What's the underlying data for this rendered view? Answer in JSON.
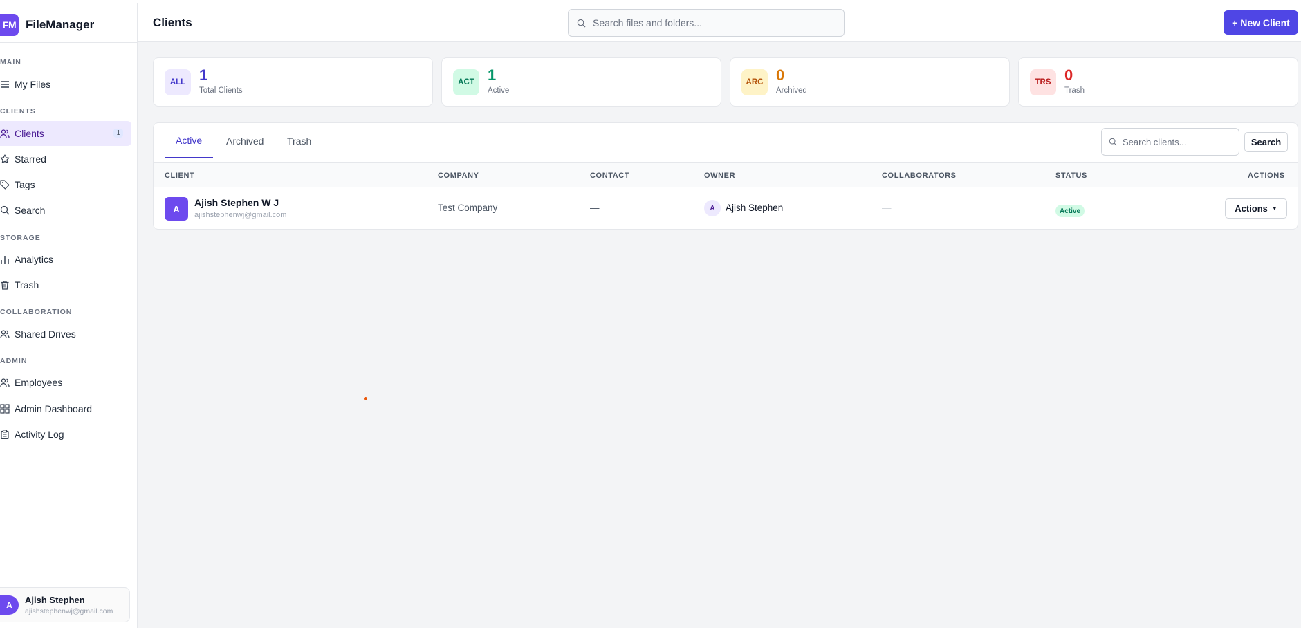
{
  "app": {
    "logo_text": "FM",
    "name": "FileManager"
  },
  "sidebar": {
    "sections": [
      {
        "label": "MAIN"
      },
      {
        "label": "CLIENTS"
      },
      {
        "label": "STORAGE"
      },
      {
        "label": "COLLABORATION"
      },
      {
        "label": "ADMIN"
      }
    ],
    "items": [
      {
        "label": "My Files",
        "icon": "menu-icon"
      },
      {
        "label": "Clients",
        "icon": "users-icon",
        "badge": "1",
        "active": true
      },
      {
        "label": "Starred",
        "icon": "star-icon"
      },
      {
        "label": "Tags",
        "icon": "tag-icon"
      },
      {
        "label": "Search",
        "icon": "search-icon"
      },
      {
        "label": "Analytics",
        "icon": "bar-chart-icon"
      },
      {
        "label": "Trash",
        "icon": "trash-icon"
      },
      {
        "label": "Shared Drives",
        "icon": "users-icon"
      },
      {
        "label": "Employees",
        "icon": "users-icon"
      },
      {
        "label": "Admin Dashboard",
        "icon": "grid-icon"
      },
      {
        "label": "Activity Log",
        "icon": "clipboard-icon"
      }
    ],
    "user": {
      "initial": "A",
      "name": "Ajish Stephen",
      "email": "ajishstephenwj@gmail.com"
    }
  },
  "header": {
    "title": "Clients",
    "search_placeholder": "Search files and folders...",
    "new_client_label": "+ New Client"
  },
  "stats": [
    {
      "chip": "ALL",
      "value": "1",
      "label": "Total Clients",
      "color": "#4338ca",
      "chip_bg": "#ede9fe"
    },
    {
      "chip": "ACT",
      "value": "1",
      "label": "Active",
      "color": "#059669",
      "chip_bg": "#d1fae5"
    },
    {
      "chip": "ARC",
      "value": "0",
      "label": "Archived",
      "color": "#d97706",
      "chip_bg": "#fef3c7"
    },
    {
      "chip": "TRS",
      "value": "0",
      "label": "Trash",
      "color": "#dc2626",
      "chip_bg": "#fee2e2"
    }
  ],
  "tabs": [
    {
      "label": "Active",
      "active": true
    },
    {
      "label": "Archived"
    },
    {
      "label": "Trash"
    }
  ],
  "client_search": {
    "placeholder": "Search clients...",
    "button_label": "Search"
  },
  "table": {
    "columns": [
      "CLIENT",
      "COMPANY",
      "CONTACT",
      "OWNER",
      "COLLABORATORS",
      "STATUS",
      "ACTIONS"
    ],
    "rows": [
      {
        "initial": "A",
        "name": "Ajish Stephen W J",
        "email": "ajishstephenwj@gmail.com",
        "company": "Test Company",
        "contact": "—",
        "owner_initial": "A",
        "owner": "Ajish Stephen",
        "collaborators": "—",
        "status": "Active",
        "actions_label": "Actions"
      }
    ]
  },
  "colors": {
    "accent": "#4f46e5",
    "brand": "#6d4aee"
  }
}
